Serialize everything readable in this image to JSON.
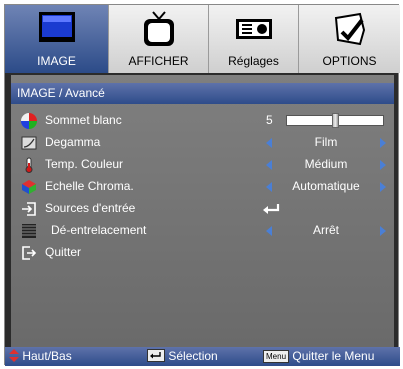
{
  "tabs": [
    {
      "label": "IMAGE",
      "icon": "monitor-icon",
      "active": true
    },
    {
      "label": "AFFICHER",
      "icon": "tv-icon",
      "active": false
    },
    {
      "label": "Réglages",
      "icon": "projector-icon",
      "active": false
    },
    {
      "label": "OPTIONS",
      "icon": "options-icon",
      "active": false
    }
  ],
  "breadcrumb": "IMAGE / Avancé",
  "items": [
    {
      "label": "Sommet blanc",
      "icon": "color-wheel-icon",
      "value": "5",
      "slider_fraction": 0.5
    },
    {
      "label": "Degamma",
      "icon": "gamma-curve-icon",
      "value": "Film"
    },
    {
      "label": "Temp. Couleur",
      "icon": "thermometer-icon",
      "value": "Médium"
    },
    {
      "label": "Echelle Chroma.",
      "icon": "color-cube-icon",
      "value": "Automatique"
    },
    {
      "label": "Sources d'entrée",
      "icon": "input-source-icon",
      "value": "↵"
    },
    {
      "label": "Dé-entrelacement",
      "icon": "deinterlace-icon",
      "value": "Arrêt"
    },
    {
      "label": "Quitter",
      "icon": "exit-icon"
    }
  ],
  "footer": {
    "nav": "Haut/Bas",
    "select": "Sélection",
    "menu_key": "Menu",
    "quit": "Quitter le Menu"
  },
  "colors": {
    "accent": "#2e4c8a",
    "arrow": "#4a7fd6",
    "panel": "#6f6f6f"
  }
}
